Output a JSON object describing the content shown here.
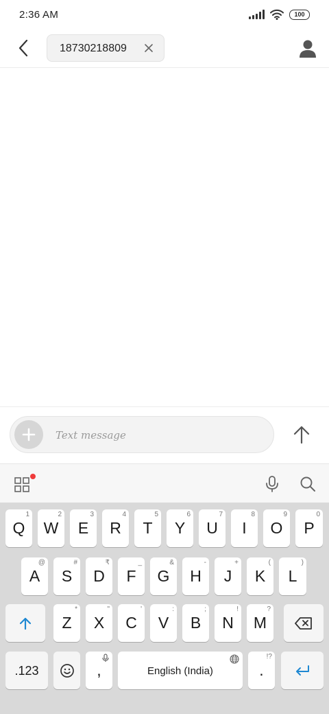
{
  "status_bar": {
    "time": "2:36 AM",
    "battery": "100"
  },
  "header": {
    "recipient": "18730218809"
  },
  "compose": {
    "placeholder": "Text message"
  },
  "keyboard": {
    "row1": [
      {
        "key": "Q",
        "sub": "1"
      },
      {
        "key": "W",
        "sub": "2"
      },
      {
        "key": "E",
        "sub": "3"
      },
      {
        "key": "R",
        "sub": "4"
      },
      {
        "key": "T",
        "sub": "5"
      },
      {
        "key": "Y",
        "sub": "6"
      },
      {
        "key": "U",
        "sub": "7"
      },
      {
        "key": "I",
        "sub": "8"
      },
      {
        "key": "O",
        "sub": "9"
      },
      {
        "key": "P",
        "sub": "0"
      }
    ],
    "row2": [
      {
        "key": "A",
        "sub": "@"
      },
      {
        "key": "S",
        "sub": "#"
      },
      {
        "key": "D",
        "sub": "₹"
      },
      {
        "key": "F",
        "sub": "_"
      },
      {
        "key": "G",
        "sub": "&"
      },
      {
        "key": "H",
        "sub": "-"
      },
      {
        "key": "J",
        "sub": "+"
      },
      {
        "key": "K",
        "sub": "("
      },
      {
        "key": "L",
        "sub": ")"
      }
    ],
    "row3": [
      {
        "key": "Z",
        "sub": "*"
      },
      {
        "key": "X",
        "sub": "\""
      },
      {
        "key": "C",
        "sub": "'"
      },
      {
        "key": "V",
        "sub": ":"
      },
      {
        "key": "B",
        "sub": ";"
      },
      {
        "key": "N",
        "sub": "!"
      },
      {
        "key": "M",
        "sub": "?"
      }
    ],
    "numbers_label": ".123",
    "comma": ",",
    "space_label": "English (India)",
    "period": ".",
    "period_sub": "!?"
  },
  "colors": {
    "accent": "#1e88d2",
    "notification_dot": "#ef3b3b"
  }
}
